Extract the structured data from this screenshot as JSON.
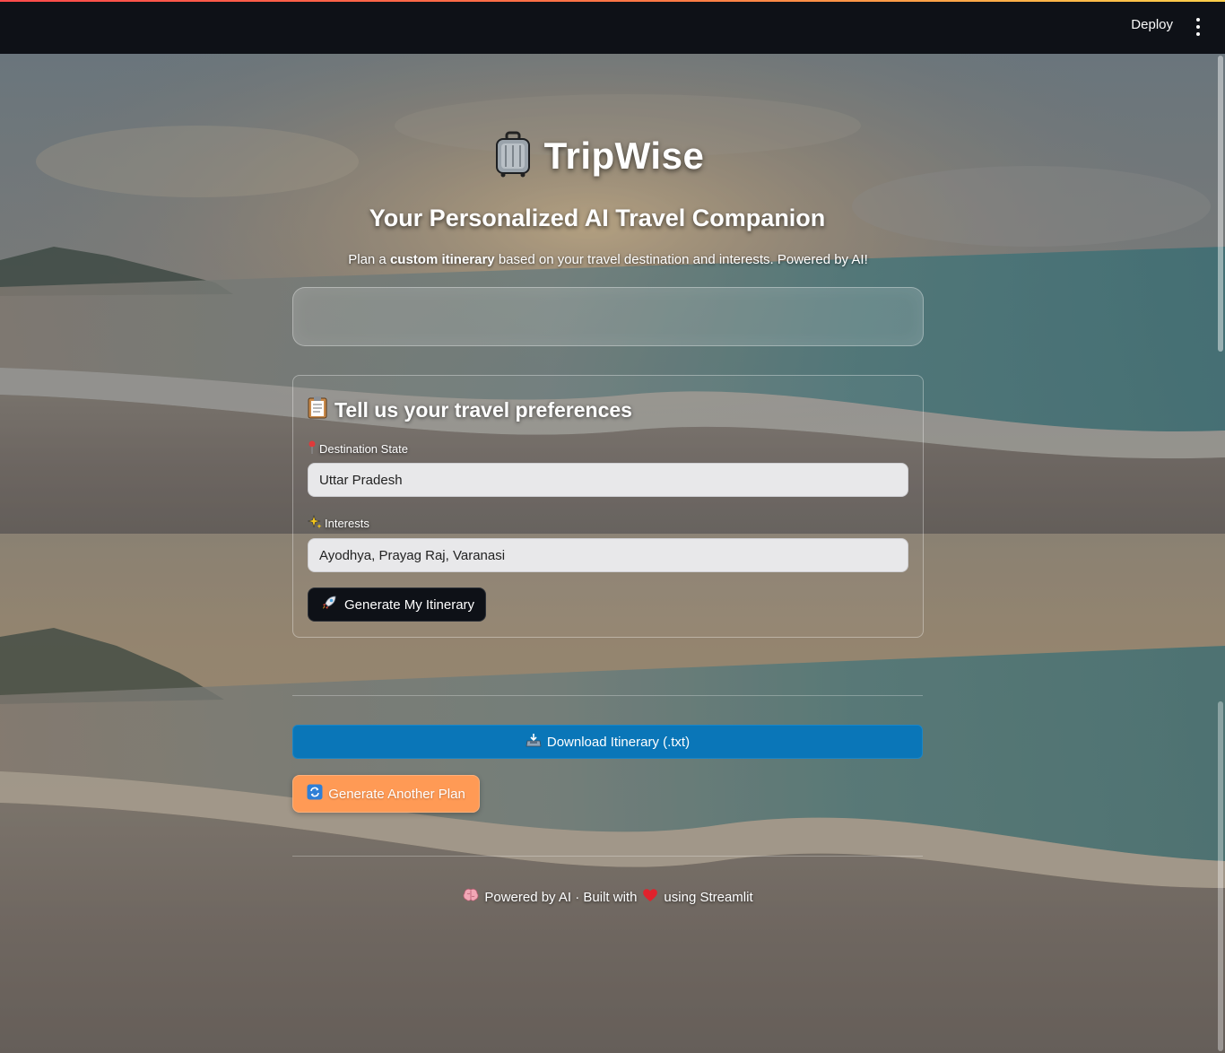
{
  "header": {
    "deploy_label": "Deploy",
    "menu_icon": "kebab-menu-icon"
  },
  "hero": {
    "title_icon": "suitcase-icon",
    "title": "TripWise",
    "subtitle": "Your Personalized AI Travel Companion",
    "tagline_prefix": "Plan a ",
    "tagline_bold": "custom itinerary",
    "tagline_suffix": " based on your travel destination and interests. Powered by AI!"
  },
  "form": {
    "heading_icon": "clipboard-icon",
    "heading": "Tell us your travel preferences",
    "destination": {
      "icon": "pin-icon",
      "label": "Destination State",
      "value": "Uttar Pradesh"
    },
    "interests": {
      "icon": "sparkles-icon",
      "label": "Interests",
      "value": "Ayodhya, Prayag Raj, Varanasi"
    },
    "generate": {
      "icon": "rocket-icon",
      "label": "Generate My Itinerary"
    }
  },
  "actions": {
    "download": {
      "icon": "inbox-tray-icon",
      "label": "Download Itinerary (.txt)"
    },
    "again": {
      "icon": "refresh-icon",
      "label": "Generate Another Plan"
    }
  },
  "footer": {
    "brain_icon": "brain-icon",
    "text_before": "Powered by AI · Built with",
    "heart_icon": "heart-icon",
    "text_after": "using Streamlit"
  },
  "colors": {
    "header_bg": "#0e1117",
    "download_blue": "#0a76b8",
    "again_orange": "#ff9a55",
    "input_bg": "#e8e8ea"
  }
}
